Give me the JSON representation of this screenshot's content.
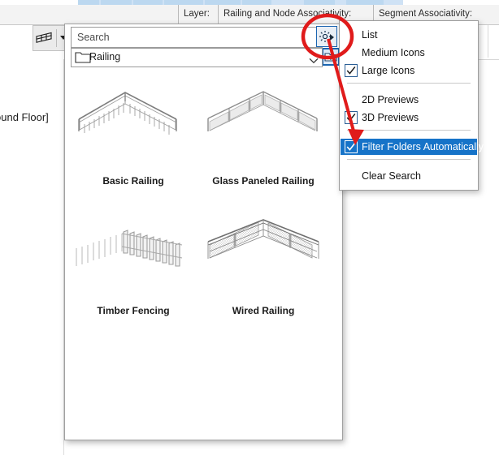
{
  "app": {
    "infobar": {
      "layer_label": "Layer:",
      "railing_assoc_label": "Railing and Node Associativity:",
      "segment_assoc_label": "Segment Associativity:"
    },
    "left_panel": {
      "floor_label": "ound Floor]"
    },
    "toolbar": {
      "tool_icon": "railing-tool-icon",
      "dropdown_icon": "caret-down-icon"
    }
  },
  "browser": {
    "search": {
      "placeholder": "Search",
      "value": "Search",
      "settings_icon": "gear-icon",
      "settings_arrow_icon": "arrow-right-icon",
      "up_folder_icon": "up-one-level-folder-icon"
    },
    "folder": {
      "icon": "folder-icon",
      "name": "Railing",
      "caret_icon": "chevron-down-icon"
    },
    "items": [
      {
        "label": "Basic Railing",
        "thumb": "basic-railing-thumbnail"
      },
      {
        "label": "Glass Paneled Railing",
        "thumb": "glass-paneled-railing-thumbnail"
      },
      {
        "label": "Timber Fencing",
        "thumb": "timber-fencing-thumbnail"
      },
      {
        "label": "Wired Railing",
        "thumb": "wired-railing-thumbnail"
      }
    ]
  },
  "context_menu": {
    "items": [
      {
        "label": "List",
        "checked": false
      },
      {
        "label": "Medium Icons",
        "checked": false
      },
      {
        "label": "Large Icons",
        "checked": true
      },
      {
        "label": "2D Previews",
        "checked": false
      },
      {
        "label": "3D Previews",
        "checked": true
      },
      {
        "label": "Filter Folders Automatically",
        "checked": true,
        "selected": true
      },
      {
        "label": "Clear Search",
        "checked": false
      }
    ]
  },
  "annotation": {
    "circle_target": "gear-icon",
    "arrow_target": "Filter Folders Automatically",
    "color": "#e01b1b"
  },
  "colors": {
    "highlight_blue": "#1673c8",
    "annotation_red": "#e01b1b",
    "accent_border_blue": "#1a64b0",
    "panel_bg": "#ffffff",
    "infobar_bg": "#f3f3f3"
  }
}
